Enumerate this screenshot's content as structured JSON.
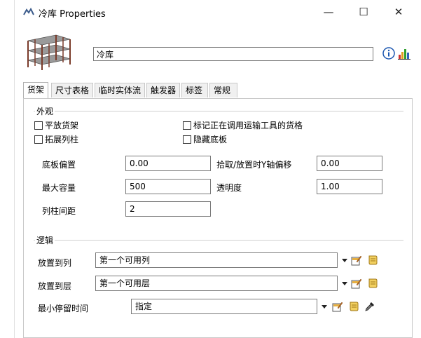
{
  "window": {
    "title": "冷库  Properties",
    "minimize": "—",
    "maximize": "☐",
    "close": "✕"
  },
  "header": {
    "name_value": "冷库",
    "info_icon": "info-icon",
    "chart_icon": "chart-icon"
  },
  "tabs": [
    {
      "label": "货架",
      "active": true
    },
    {
      "label": "尺寸表格",
      "active": false
    },
    {
      "label": "临时实体流",
      "active": false
    },
    {
      "label": "触发器",
      "active": false
    },
    {
      "label": "标签",
      "active": false
    },
    {
      "label": "常规",
      "active": false
    }
  ],
  "appearance": {
    "group_label": "外观",
    "checkboxes": {
      "flat_rack": "平放货架",
      "extend_columns": "拓展列柱",
      "mark_transport": "标记正在调用运输工具的货格",
      "hide_floor": "隐藏底板"
    },
    "floor_offset_label": "底板偏置",
    "floor_offset_value": "0.00",
    "pick_y_offset_label": "拾取/放置时Y轴偏移",
    "pick_y_offset_value": "0.00",
    "max_capacity_label": "最大容量",
    "max_capacity_value": "500",
    "opacity_label": "透明度",
    "opacity_value": "1.00",
    "column_spacing_label": "列柱间距",
    "column_spacing_value": "2"
  },
  "logic": {
    "group_label": "逻辑",
    "place_in_bay_label": "放置到列",
    "place_in_bay_value": "第一个可用列",
    "place_in_level_label": "放置到层",
    "place_in_level_value": "第一个可用层",
    "min_dwell_label": "最小停留时间",
    "min_dwell_value": "指定"
  },
  "colors": {
    "border": "#7a7a7a",
    "tab_bg": "#f0f0f0",
    "accent_blue": "#1a56b0"
  }
}
